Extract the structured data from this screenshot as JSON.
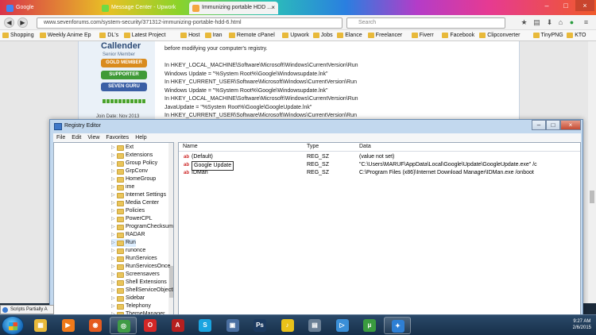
{
  "browser": {
    "tabs": [
      {
        "label": "Google",
        "color": "#4285f4",
        "active": false
      },
      {
        "label": "Message Center - Upwork",
        "color": "#6fda44",
        "active": false
      },
      {
        "label": "Immunizing portable HDD ...",
        "color": "#f4a640",
        "active": true
      }
    ],
    "url": "www.sevenforums.com/system-security/371312-immunizing-portable-hdd-6.html",
    "search_placeholder": "Search",
    "bookmarks": [
      "Shopping",
      "Weekly Anime Ep",
      "DL's",
      "Latest Project",
      "Host",
      "Iran",
      "Remote cPanel",
      "Upwork",
      "Jobs",
      "Elance",
      "Freelancer",
      "Fiverr",
      "Facebook",
      "Clipconverter",
      "TinyPNG",
      "KTO"
    ]
  },
  "forum": {
    "username": "Callender",
    "user_title": "Senior Member",
    "ranks": [
      {
        "label": "GOLD MEMBER",
        "color": "#d98b1e"
      },
      {
        "label": "SUPPORTER",
        "color": "#3f9a37"
      },
      {
        "label": "SEVEN GURU",
        "color": "#3a5fa5"
      }
    ],
    "join_date": "Join Date: Nov 2013",
    "post_lines": [
      "before modifying your computer's registry.",
      "",
      "In HKEY_LOCAL_MACHINE\\Software\\Microsoft\\Windows\\CurrentVersion\\Run",
      "Windows Update = \"%System Root%\\Google\\Windowsupdate.lnk\"",
      "In HKEY_CURRENT_USER\\Software\\Microsoft\\Windows\\CurrentVersion\\Run",
      "Windows Update = \"%System Root%\\Google\\Windowsupdate.lnk\"",
      "In HKEY_LOCAL_MACHINE\\Software\\Microsoft\\Windows\\CurrentVersion\\Run",
      "JavaUpdate = \"%System Root%\\Google\\GoogleUpdate.lnk\"",
      "In HKEY_CURRENT_USER\\Software\\Microsoft\\Windows\\CurrentVersion\\Run"
    ]
  },
  "regedit": {
    "title": "Registry Editor",
    "menu": [
      "File",
      "Edit",
      "View",
      "Favorites",
      "Help"
    ],
    "tree": [
      "Ext",
      "Extensions",
      "Group Policy",
      "GrpConv",
      "HomeGroup",
      "ime",
      "Internet Settings",
      "Media Center",
      "Policies",
      "PowerCPL",
      "ProgramChecksum",
      "RADAR",
      "Run",
      "runonce",
      "RunServices",
      "RunServicesOnce",
      "Screensavers",
      "Shell Extensions",
      "ShellServiceObjectD",
      "Sidebar",
      "Telephony",
      "ThemeManager"
    ],
    "columns": {
      "name": "Name",
      "type": "Type",
      "data": "Data"
    },
    "values": [
      {
        "name": "(Default)",
        "type": "REG_SZ",
        "data": "(value not set)",
        "editing": false
      },
      {
        "name": "Google Update",
        "type": "REG_SZ",
        "data": "\"C:\\Users\\MARUF\\AppData\\Local\\Google\\Update\\GoogleUpdate.exe\" /c",
        "editing": true
      },
      {
        "name": "IDMan",
        "type": "REG_SZ",
        "data": "C:\\Program Files (x86)\\Internet Download Manager\\IDMan.exe /onboot",
        "editing": false
      }
    ]
  },
  "taskbar": {
    "notification": "Scripts Partially A",
    "time": "9:27 AM",
    "date": "2/6/2015",
    "apps": [
      {
        "icon": "explorer-icon",
        "color": "#e8b93a",
        "running": false
      },
      {
        "icon": "media-player-icon",
        "color": "#f07a1a",
        "running": false
      },
      {
        "icon": "firefox-icon",
        "color": "#e55b1f",
        "running": false
      },
      {
        "icon": "chrome-icon",
        "color": "#3f9b45",
        "running": true
      },
      {
        "icon": "opera-icon",
        "color": "#d42727",
        "running": false
      },
      {
        "icon": "acrobat-icon",
        "color": "#b71f1f",
        "running": false
      },
      {
        "icon": "skype-icon",
        "color": "#1aa4e0",
        "running": false
      },
      {
        "icon": "shell-icon",
        "color": "#4a6fa1",
        "running": false
      },
      {
        "icon": "photoshop-icon",
        "color": "#1c3a60",
        "running": false
      },
      {
        "icon": "winamp-icon",
        "color": "#e9c21a",
        "running": false
      },
      {
        "icon": "app-icon",
        "color": "#6a7f95",
        "running": false
      },
      {
        "icon": "play-icon",
        "color": "#3a8fd8",
        "running": false
      },
      {
        "icon": "utorrent-icon",
        "color": "#3a9b3f",
        "running": false
      },
      {
        "icon": "regedit-icon",
        "color": "#2e7fd4",
        "running": true
      }
    ]
  }
}
